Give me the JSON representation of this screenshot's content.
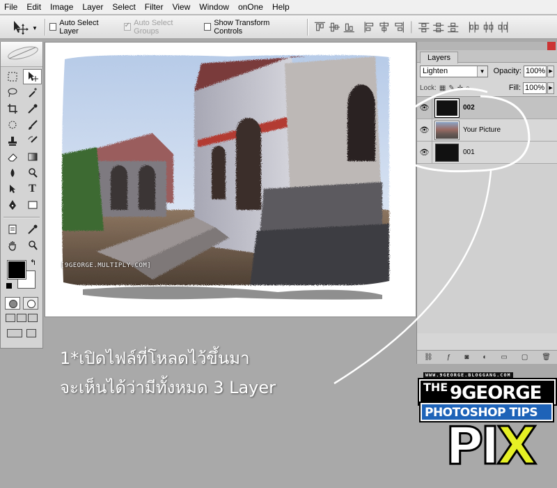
{
  "menu": [
    "File",
    "Edit",
    "Image",
    "Layer",
    "Select",
    "Filter",
    "View",
    "Window",
    "onOne",
    "Help"
  ],
  "options": {
    "auto_select_layer": "Auto Select Layer",
    "auto_select_groups": "Auto Select Groups",
    "show_transform_controls": "Show Transform Controls"
  },
  "document": {
    "watermark": "[9GEORGE.MULTIPLY.COM]"
  },
  "layers_panel": {
    "tab": "Layers",
    "blend_mode": "Lighten",
    "opacity_label": "Opacity:",
    "opacity": "100%",
    "fill_label": "Fill:",
    "fill": "100%",
    "lock_label": "Lock:",
    "layers": [
      {
        "name": "002",
        "active": true
      },
      {
        "name": "Your Picture",
        "active": false
      },
      {
        "name": "001",
        "active": false
      }
    ]
  },
  "annotation": {
    "line1": "1*เปิดไฟล์ที่โหลดไว้ขึ้นมา",
    "line2": "จะเห็นได้ว่ามีทั้งหมด 3 Layer"
  },
  "logo": {
    "site": "WWW.9GEORGE.BLOGGANG.COM",
    "the": "THE",
    "brand": "9GEORGE",
    "subtitle": "PHOTOSHOP TIPS",
    "pi": "PI",
    "x": "X"
  },
  "colors": {
    "foreground": "#000000",
    "background": "#ffffff",
    "canvas_bg": "#a9a9a9",
    "logo_blue": "#1e63b8",
    "logo_yellow": "#e6f024"
  }
}
